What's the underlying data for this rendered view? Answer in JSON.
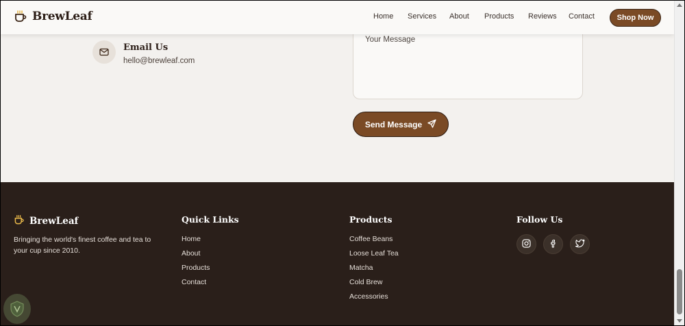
{
  "brand": {
    "name": "BrewLeaf"
  },
  "nav": {
    "items": [
      "Home",
      "Services",
      "About",
      "Products",
      "Reviews",
      "Contact"
    ],
    "cta": "Shop Now"
  },
  "contact": {
    "email_title": "Email Us",
    "email_value": "hello@brewleaf.com",
    "message_placeholder": "Your Message",
    "send_label": "Send Message"
  },
  "footer": {
    "brand": "BrewLeaf",
    "description": "Bringing the world's finest coffee and tea to your cup since 2010.",
    "quick_links": {
      "heading": "Quick Links",
      "items": [
        "Home",
        "About",
        "Products",
        "Contact"
      ]
    },
    "products": {
      "heading": "Products",
      "items": [
        "Coffee Beans",
        "Loose Leaf Tea",
        "Matcha",
        "Cold Brew",
        "Accessories"
      ]
    },
    "follow": {
      "heading": "Follow Us",
      "icons": [
        "instagram-icon",
        "facebook-icon",
        "twitter-icon"
      ]
    }
  },
  "colors": {
    "accent": "#7a4a25",
    "logo_gold": "#e8b84a",
    "footer_bg": "#2a1f1a",
    "page_bg": "#f3f1ee"
  }
}
